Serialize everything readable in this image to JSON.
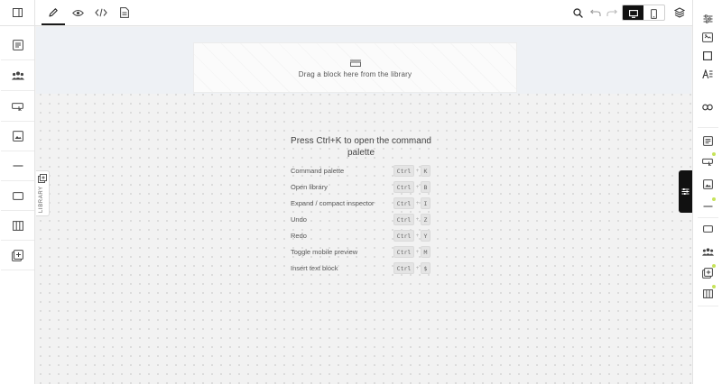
{
  "left_rail": {
    "toggle_icon": "sidebar-toggle-icon",
    "items": [
      {
        "icon": "text-block-icon"
      },
      {
        "icon": "team-icon"
      },
      {
        "icon": "button-block-icon"
      },
      {
        "icon": "image-block-icon"
      },
      {
        "icon": "divider-icon"
      },
      {
        "icon": "container-icon"
      },
      {
        "icon": "columns-icon"
      },
      {
        "icon": "add-block-icon"
      }
    ]
  },
  "toolbar": {
    "modes": [
      {
        "icon": "pencil-edit-icon",
        "active": true
      },
      {
        "icon": "eye-preview-icon"
      },
      {
        "icon": "code-icon"
      },
      {
        "icon": "document-icon"
      }
    ],
    "right_tools": [
      "search-icon",
      "undo-icon",
      "redo-icon"
    ],
    "device": {
      "selected": "desktop",
      "options": [
        "desktop",
        "mobile"
      ]
    },
    "layers_icon": "layers-icon"
  },
  "canvas": {
    "drop_zone": {
      "label": "Drag a block here from the library"
    },
    "palette_title": "Press Ctrl+K to open the command palette",
    "shortcuts": [
      {
        "label": "Command palette",
        "modifier": "Ctrl",
        "key": "K"
      },
      {
        "label": "Open library",
        "modifier": "Ctrl",
        "key": "B"
      },
      {
        "label": "Expand / compact inspector",
        "modifier": "Ctrl",
        "key": "I"
      },
      {
        "label": "Undo",
        "modifier": "Ctrl",
        "key": "Z"
      },
      {
        "label": "Redo",
        "modifier": "Ctrl",
        "key": "Y"
      },
      {
        "label": "Toggle mobile preview",
        "modifier": "Ctrl",
        "key": "M"
      },
      {
        "label": "Insert text block",
        "modifier": "Ctrl",
        "key": "$"
      }
    ]
  },
  "library_tab": {
    "label": "LIBRARY"
  },
  "inspector_tab": {
    "icon": "sliders-icon"
  },
  "right_rail": {
    "items": [
      {
        "icon": "sliders-icon"
      },
      {
        "icon": "swap-image-icon"
      },
      {
        "icon": "square-icon"
      },
      {
        "icon": "text-style-icon"
      },
      {
        "icon": "link-icon"
      },
      {
        "icon": "text-block-icon"
      },
      {
        "icon": "button-block-icon",
        "status": "new"
      },
      {
        "icon": "image-block-icon"
      },
      {
        "icon": "divider-icon",
        "status": "new"
      },
      {
        "icon": "container-icon"
      },
      {
        "icon": "team-icon"
      },
      {
        "icon": "add-block-icon",
        "status": "new"
      },
      {
        "icon": "columns-icon",
        "status": "new"
      }
    ]
  },
  "colors": {
    "accent": "#111111",
    "status_dot": "#c6e35a",
    "band": "#eef1f5"
  }
}
